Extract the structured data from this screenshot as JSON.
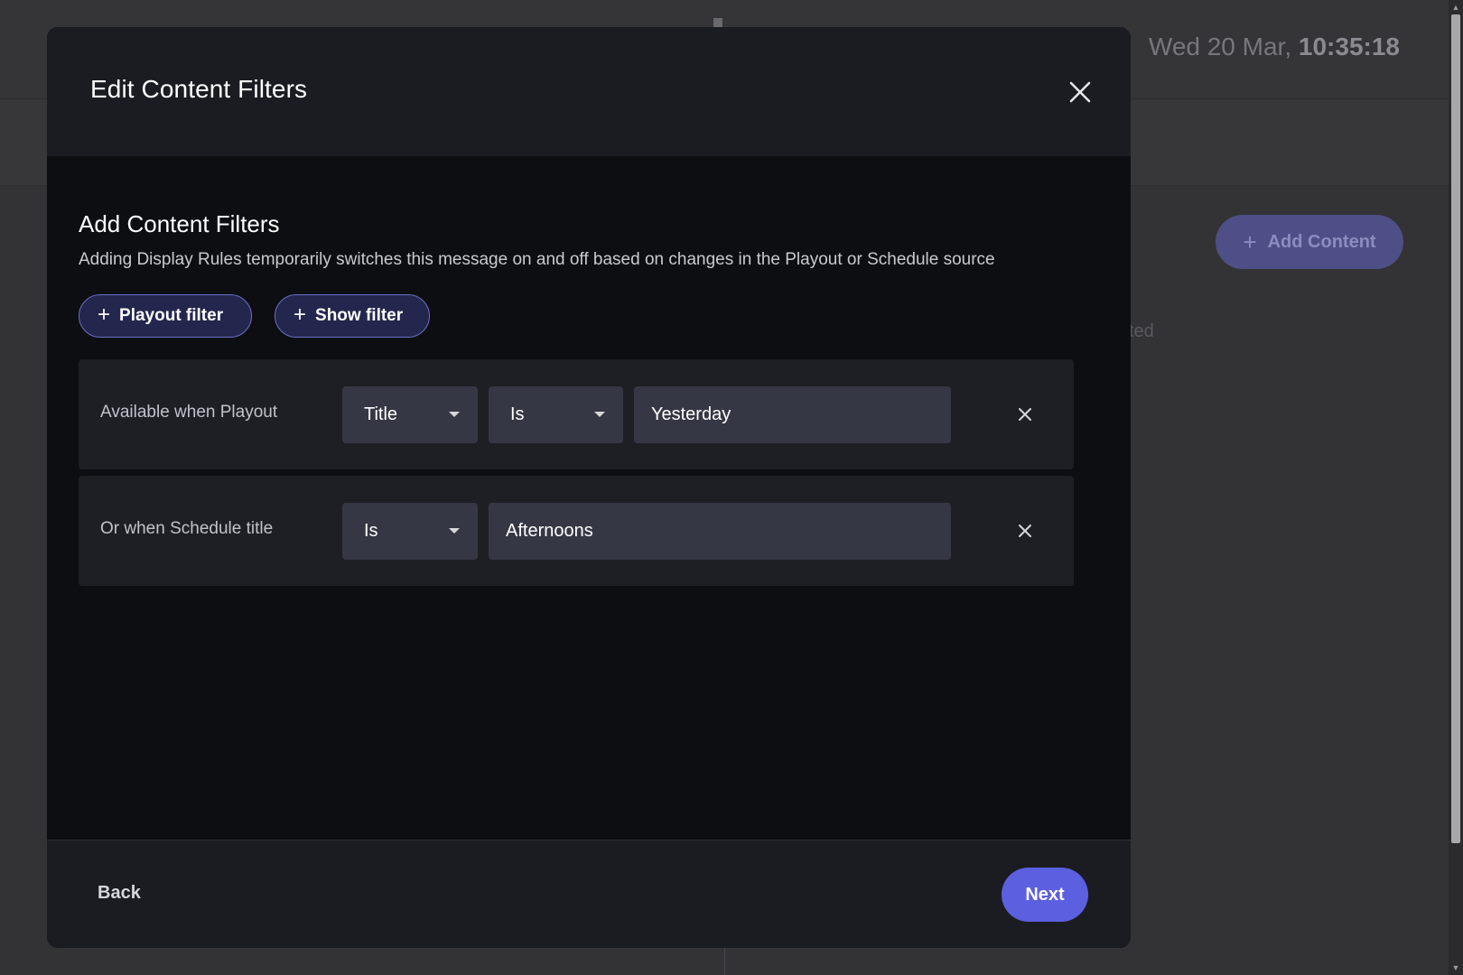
{
  "background": {
    "clock_date": "Wed 20 Mar,",
    "clock_time": "10:35:18",
    "add_content_label": "Add Content",
    "faint_text": "ted"
  },
  "modal": {
    "title": "Edit Content Filters",
    "section_title": "Add Content Filters",
    "section_description": "Adding Display Rules temporarily switches this message on and off based on changes in the Playout or Schedule source",
    "add_buttons": {
      "playout_filter": "Playout filter",
      "show_filter": "Show filter"
    },
    "filters": [
      {
        "label": "Available when Playout",
        "field": "Title",
        "operator": "Is",
        "value": "Yesterday"
      },
      {
        "label": "Or when Schedule title",
        "operator": "Is",
        "value": "Afternoons"
      }
    ],
    "footer": {
      "back_label": "Back",
      "next_label": "Next"
    }
  },
  "colors": {
    "accent": "#5c5fe0",
    "chip_border": "#6b6fc4",
    "modal_body": "#0d0e12",
    "modal_header": "#1b1c21",
    "filter_row": "#1e1f25",
    "input": "#363744"
  },
  "icons": {
    "close": "close-icon",
    "plus": "plus-icon",
    "dropdown": "caret-down-icon",
    "remove": "remove-icon"
  }
}
